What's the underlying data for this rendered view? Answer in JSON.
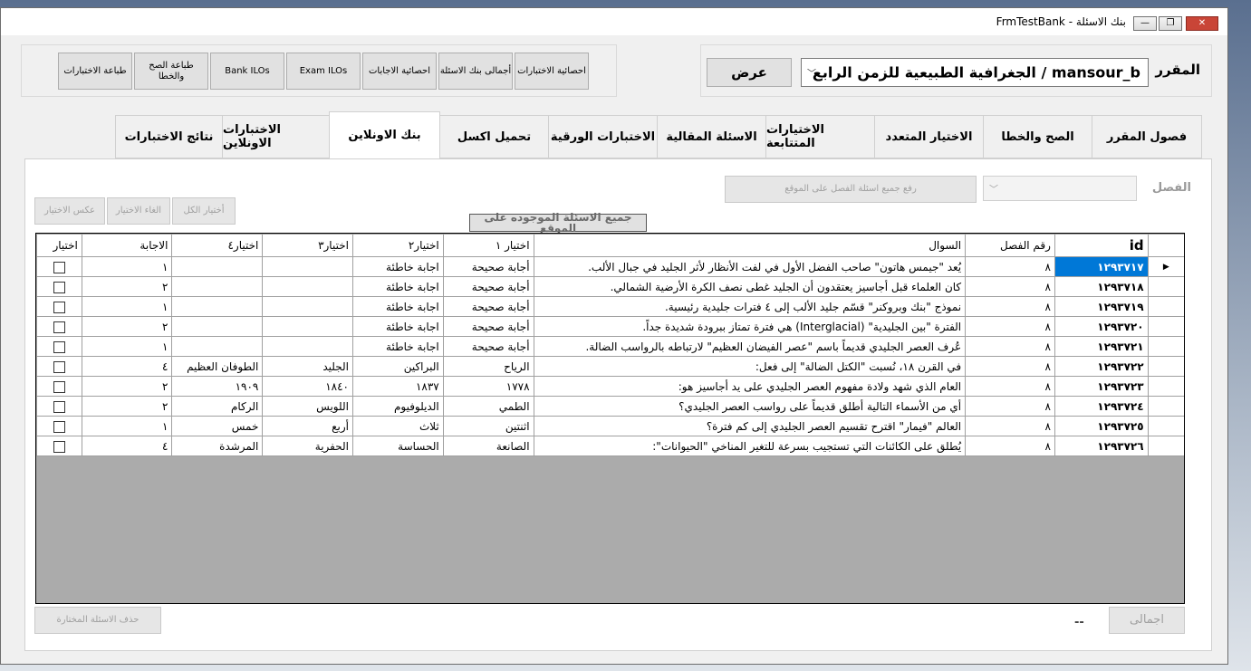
{
  "window": {
    "title": "FrmTestBank - بنك الاسئلة",
    "minimize_glyph": "—",
    "restore_glyph": "❐",
    "close_glyph": "✕"
  },
  "header": {
    "course_label": "المقرر",
    "course_value": "الجغرافية الطبيعية للزمن الرابع / mansour_b",
    "show_button": "عرض",
    "stat_buttons": [
      "احصائية الاختبارات",
      "أجمالى بنك الاسئلة",
      "احصائية الاجابات",
      "Exam ILOs",
      "Bank ILOs",
      "طباعة الصح والخطا",
      "طباعة الاختبارات"
    ]
  },
  "tabs": [
    "فصول المقرر",
    "الصح والخطا",
    "الاختيار المتعدد",
    "الاختيارات المتتابعة",
    "الاسئلة المقالية",
    "الاختبارات الورقية",
    "تحميل اكسل",
    "بنك الاونلاين",
    "الاختبارات الاونلاين",
    "نتائج الاختبارات"
  ],
  "active_tab_index": 7,
  "panel": {
    "chapter_label": "الفصل",
    "upload_button": "رفع جميع اسئلة الفصل على الموقع",
    "select_all": "أختيار الكل",
    "cancel_select": "الغاء الاختيار",
    "invert_select": "عكس الاختيار",
    "all_on_site": "جميع الاسئلة الموجوده على الموقع",
    "delete_selected": "حذف الاسئلة المختارة",
    "total_button": "اجمالى",
    "total_value": "--"
  },
  "grid": {
    "columns": [
      "id",
      "رقم الفصل",
      "السوال",
      "اختيار ١",
      "اختيار٢",
      "اختيار٣",
      "اختيار٤",
      "الاجابة",
      "اختيار"
    ],
    "row_pointer": "▶",
    "rows": [
      {
        "id": "١٢٩٣٧١٧",
        "ch": "٨",
        "q": "يُعد \"جيمس هاتون\" صاحب الفضل الأول في لفت الأنظار لأثر الجليد في جبال الألب.",
        "c1": "أجابة صحيحة",
        "c2": "اجابة خاطئة",
        "c3": "",
        "c4": "",
        "ans": "١",
        "selected": true
      },
      {
        "id": "١٢٩٣٧١٨",
        "ch": "٨",
        "q": "كان العلماء قبل أجاسيز يعتقدون أن الجليد غطى نصف الكرة الأرضية الشمالي.",
        "c1": "أجابة صحيحة",
        "c2": "اجابة خاطئة",
        "c3": "",
        "c4": "",
        "ans": "٢",
        "selected": false
      },
      {
        "id": "١٢٩٣٧١٩",
        "ch": "٨",
        "q": "نموذج \"بنك وبروكنر\" قسّم جليد الألب إلى ٤ فترات جليدية رئيسية.",
        "c1": "أجابة صحيحة",
        "c2": "اجابة خاطئة",
        "c3": "",
        "c4": "",
        "ans": "١",
        "selected": false
      },
      {
        "id": "١٢٩٣٧٢٠",
        "ch": "٨",
        "q": "الفترة \"بين الجليدية\" (Interglacial) هي فترة تمتاز ببرودة شديدة جداً.",
        "c1": "أجابة صحيحة",
        "c2": "اجابة خاطئة",
        "c3": "",
        "c4": "",
        "ans": "٢",
        "selected": false
      },
      {
        "id": "١٢٩٣٧٢١",
        "ch": "٨",
        "q": "عُرف العصر الجليدي قديماً باسم \"عصر الفيضان العظيم\" لارتباطه بالرواسب الضالة.",
        "c1": "أجابة صحيحة",
        "c2": "اجابة خاطئة",
        "c3": "",
        "c4": "",
        "ans": "١",
        "selected": false
      },
      {
        "id": "١٢٩٣٧٢٢",
        "ch": "٨",
        "q": "في القرن ١٨، نُسبت \"الكتل الضالة\" إلى فعل:",
        "c1": "الرياح",
        "c2": "البراكين",
        "c3": "الجليد",
        "c4": "الطوفان العظيم",
        "ans": "٤",
        "selected": false
      },
      {
        "id": "١٢٩٣٧٢٣",
        "ch": "٨",
        "q": "العام الذي شهد ولادة مفهوم العصر الجليدي على يد أجاسيز هو:",
        "c1": "١٧٧٨",
        "c2": "١٨٣٧",
        "c3": "١٨٤٠",
        "c4": "١٩٠٩",
        "ans": "٢",
        "selected": false
      },
      {
        "id": "١٢٩٣٧٢٤",
        "ch": "٨",
        "q": "أي من الأسماء التالية أطلق قديماً على رواسب العصر الجليدي؟",
        "c1": "الطمي",
        "c2": "الديلوفيوم",
        "c3": "اللويس",
        "c4": "الركام",
        "ans": "٢",
        "selected": false
      },
      {
        "id": "١٢٩٣٧٢٥",
        "ch": "٨",
        "q": "العالم \"فيمار\" اقترح تقسيم العصر الجليدي إلى كم فترة؟",
        "c1": "اثنتين",
        "c2": "ثلاث",
        "c3": "أربع",
        "c4": "خمس",
        "ans": "١",
        "selected": false
      },
      {
        "id": "١٢٩٣٧٢٦",
        "ch": "٨",
        "q": "يُطلق على الكائنات التي تستجيب بسرعة للتغير المناخي \"الحيوانات\":",
        "c1": "الصانعة",
        "c2": "الحساسة",
        "c3": "الحفرية",
        "c4": "المرشدة",
        "ans": "٤",
        "selected": false
      }
    ]
  },
  "colors": {
    "selection": "#0078d7",
    "grid_empty": "#ababab"
  }
}
